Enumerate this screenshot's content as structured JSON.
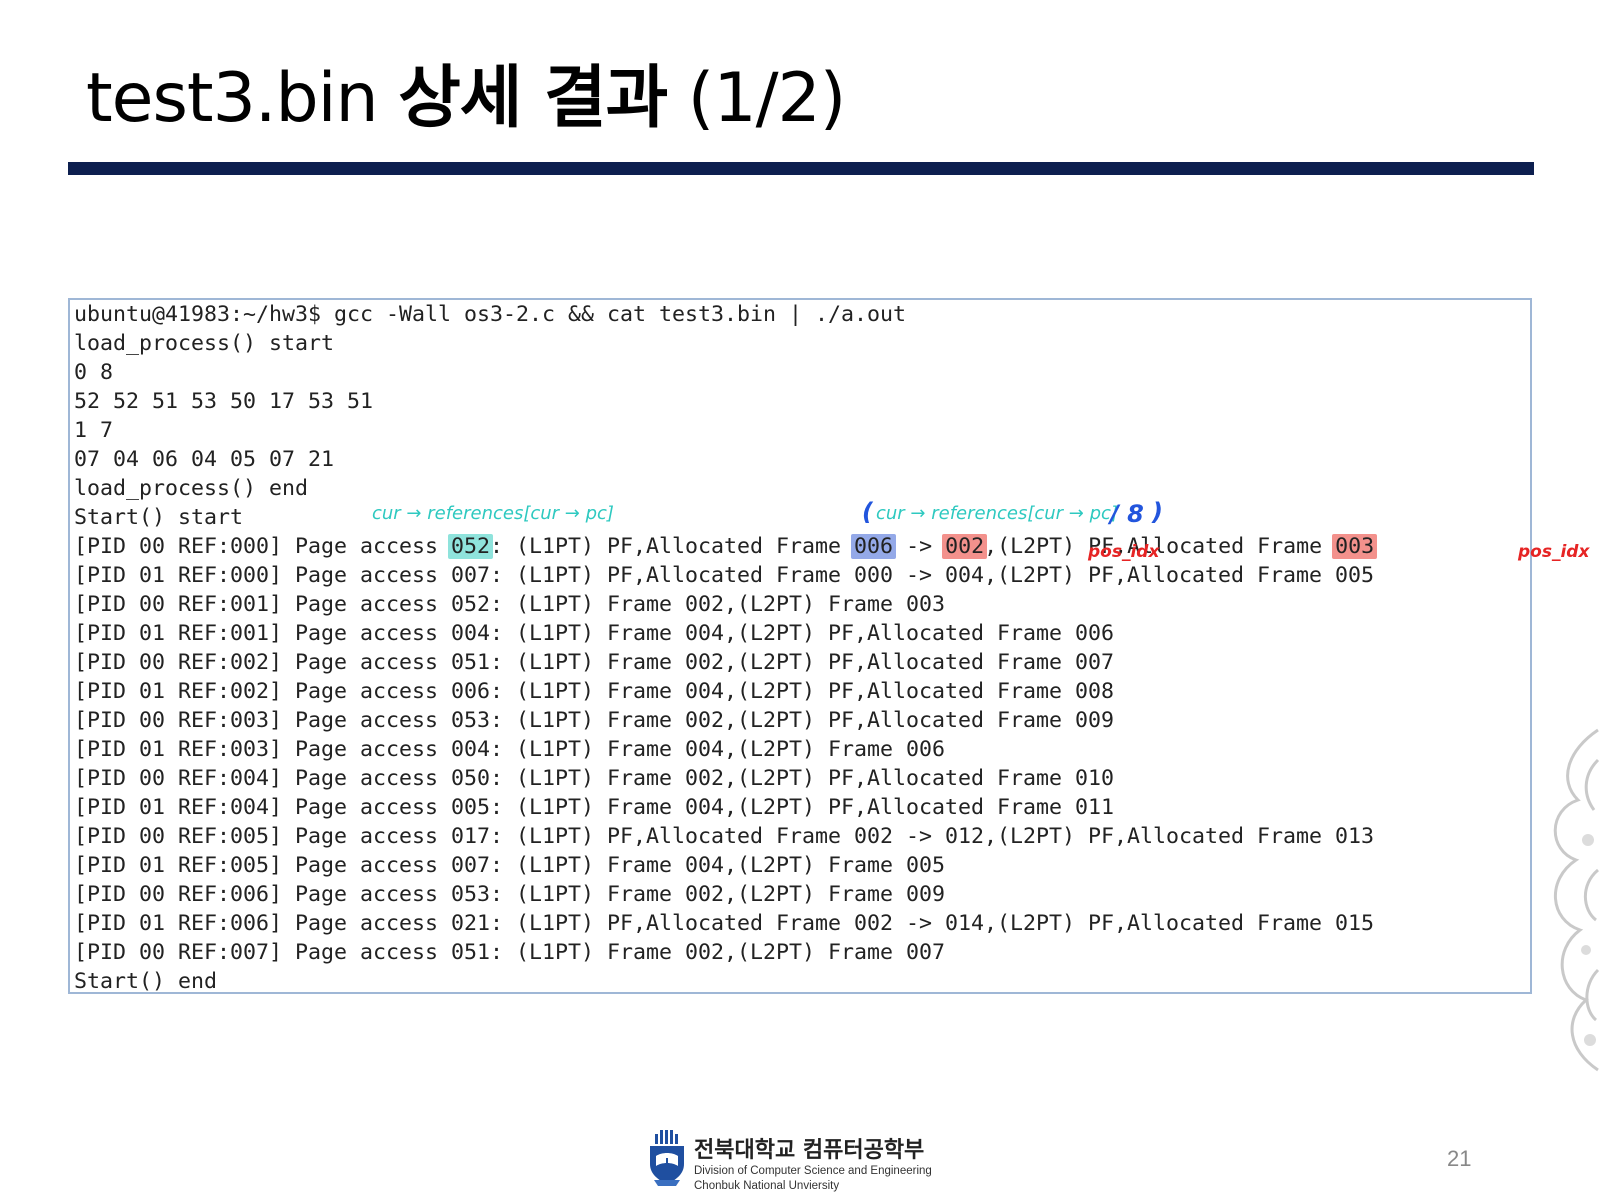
{
  "slide": {
    "title_prefix": "test3.bin ",
    "title_korean": "상세 결과",
    "title_suffix": " (1/2)",
    "page_number": "21"
  },
  "terminal": {
    "lines": [
      "ubuntu@41983:~/hw3$ gcc -Wall os3-2.c && cat test3.bin | ./a.out",
      "load_process() start",
      "0 8",
      "52 52 51 53 50 17 53 51",
      "1 7",
      "07 04 06 04 05 07 21",
      "load_process() end",
      "Start() start",
      "[PID 00 REF:000] Page access 052: (L1PT) PF,Allocated Frame 006 -> 002,(L2PT) PF,Allocated Frame 003",
      "[PID 01 REF:000] Page access 007: (L1PT) PF,Allocated Frame 000 -> 004,(L2PT) PF,Allocated Frame 005",
      "[PID 00 REF:001] Page access 052: (L1PT) Frame 002,(L2PT) Frame 003",
      "[PID 01 REF:001] Page access 004: (L1PT) Frame 004,(L2PT) PF,Allocated Frame 006",
      "[PID 00 REF:002] Page access 051: (L1PT) Frame 002,(L2PT) PF,Allocated Frame 007",
      "[PID 01 REF:002] Page access 006: (L1PT) Frame 004,(L2PT) PF,Allocated Frame 008",
      "[PID 00 REF:003] Page access 053: (L1PT) Frame 002,(L2PT) PF,Allocated Frame 009",
      "[PID 01 REF:003] Page access 004: (L1PT) Frame 004,(L2PT) Frame 006",
      "[PID 00 REF:004] Page access 050: (L1PT) Frame 002,(L2PT) PF,Allocated Frame 010",
      "[PID 01 REF:004] Page access 005: (L1PT) Frame 004,(L2PT) PF,Allocated Frame 011",
      "[PID 00 REF:005] Page access 017: (L1PT) PF,Allocated Frame 002 -> 012,(L2PT) PF,Allocated Frame 013",
      "[PID 01 REF:005] Page access 007: (L1PT) Frame 004,(L2PT) Frame 005",
      "[PID 00 REF:006] Page access 053: (L1PT) Frame 002,(L2PT) Frame 009",
      "[PID 01 REF:006] Page access 021: (L1PT) PF,Allocated Frame 002 -> 014,(L2PT) PF,Allocated Frame 015",
      "[PID 00 REF:007] Page access 051: (L1PT) Frame 002,(L2PT) Frame 007",
      "Start() end"
    ],
    "highlighted_line": {
      "a": "[PID 00 REF:000] Page access ",
      "h1": "052",
      "b": ": (L1PT) PF,Allocated Frame ",
      "h2": "006",
      "c": " -> ",
      "h3": "002",
      "d": ",(L2PT) PF,Allocated Frame ",
      "h4": "003"
    }
  },
  "annotations": {
    "cyan_note": "cur → references[cur → pc]",
    "blue_note": "cur → references[cur → pc]",
    "blue_divisor": "/ 8",
    "red_note_1": "pos_idx",
    "red_note_2": "pos_idx"
  },
  "footer": {
    "dept_korean": "전북대학교 컴퓨터공학부",
    "dept_english": "Division of Computer Science and Engineering",
    "university": "Chonbuk National Unviersity"
  },
  "colors": {
    "rule": "#0d1f4f",
    "highlight_cyan": "#8fe3dc",
    "highlight_blue": "#94a9e8",
    "highlight_red": "#f3918c"
  }
}
